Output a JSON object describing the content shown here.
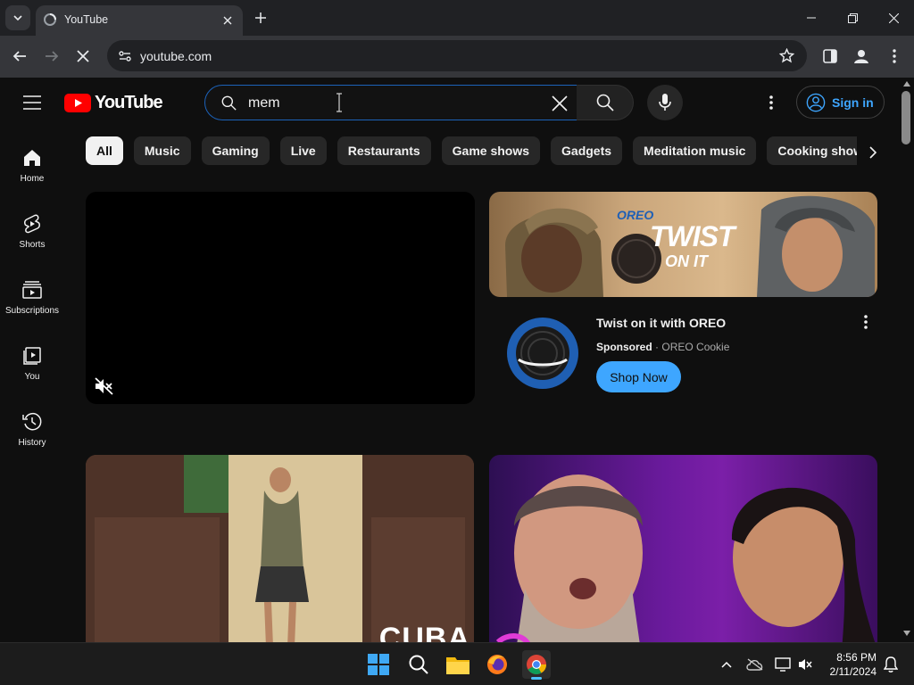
{
  "browser": {
    "tab_title": "YouTube",
    "url": "youtube.com"
  },
  "youtube": {
    "logo_text": "YouTube",
    "search": {
      "value": "mem"
    },
    "signin_label": "Sign in",
    "sidebar": [
      {
        "label": "Home",
        "icon": "home-icon"
      },
      {
        "label": "Shorts",
        "icon": "shorts-icon"
      },
      {
        "label": "Subscriptions",
        "icon": "subscriptions-icon"
      },
      {
        "label": "You",
        "icon": "you-icon"
      },
      {
        "label": "History",
        "icon": "history-icon"
      }
    ],
    "chips": [
      "All",
      "Music",
      "Gaming",
      "Live",
      "Restaurants",
      "Game shows",
      "Gadgets",
      "Meditation music",
      "Cooking shows"
    ],
    "active_chip": "All",
    "ad": {
      "title": "Twist on it with OREO",
      "sponsored": "Sponsored",
      "channel": "OREO Cookie",
      "cta": "Shop Now",
      "thumb_brand": "OREO",
      "thumb_slogan_1": "TWIST",
      "thumb_slogan_2": "ON IT"
    },
    "thumb3_text": "CUBA"
  },
  "taskbar": {
    "time": "8:56 PM",
    "date": "2/11/2024"
  },
  "colors": {
    "accent_blue": "#3ea6ff",
    "yt_red": "#ff0000",
    "bg": "#0f0f0f"
  }
}
